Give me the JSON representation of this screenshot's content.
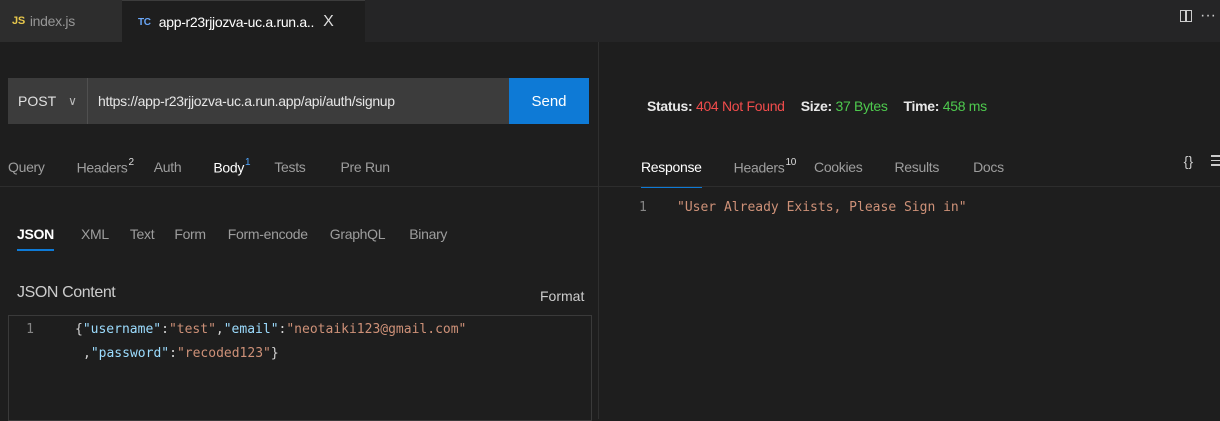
{
  "tabs": [
    {
      "badge": "JS",
      "label": "index.js"
    },
    {
      "badge": "TC",
      "label": "app-r23rjjozva-uc.a.run.a..",
      "close": "X"
    }
  ],
  "request": {
    "method": "POST",
    "url": "https://app-r23rjjozva-uc.a.run.app/api/auth/signup",
    "send_label": "Send",
    "tabs": [
      {
        "label": "Query"
      },
      {
        "label": "Headers",
        "count": "2"
      },
      {
        "label": "Auth"
      },
      {
        "label": "Body",
        "count": "1"
      },
      {
        "label": "Tests"
      },
      {
        "label": "Pre Run"
      }
    ],
    "body_types": [
      "JSON",
      "XML",
      "Text",
      "Form",
      "Form-encode",
      "GraphQL",
      "Binary"
    ],
    "json_content_label": "JSON Content",
    "format_label": "Format",
    "editor_line_numbers": [
      "1"
    ],
    "editor_lines": [
      "{\"username\":\"test\",\"email\":\"neotaiki123@gmail.com\"",
      ",\"password\":\"recoded123\"}"
    ]
  },
  "response": {
    "status_label": "Status:",
    "status_value": "404 Not Found",
    "size_label": "Size:",
    "size_value": "37 Bytes",
    "time_label": "Time:",
    "time_value": "458 ms",
    "tabs": [
      {
        "label": "Response"
      },
      {
        "label": "Headers",
        "count": "10"
      },
      {
        "label": "Cookies"
      },
      {
        "label": "Results"
      },
      {
        "label": "Docs"
      }
    ],
    "braces_icon": "{}",
    "line_number": "1",
    "body_line": "\"User Already Exists, Please Sign in\""
  },
  "colors": {
    "accent": "#0e7ad6",
    "error": "#f14c4c",
    "success": "#4ec94e",
    "json_key": "#9cdcfe",
    "json_string": "#ce9178"
  },
  "icons": [
    "split-editor-icon",
    "more-actions-icon",
    "chevron-down-icon",
    "braces-icon",
    "menu-icon"
  ]
}
